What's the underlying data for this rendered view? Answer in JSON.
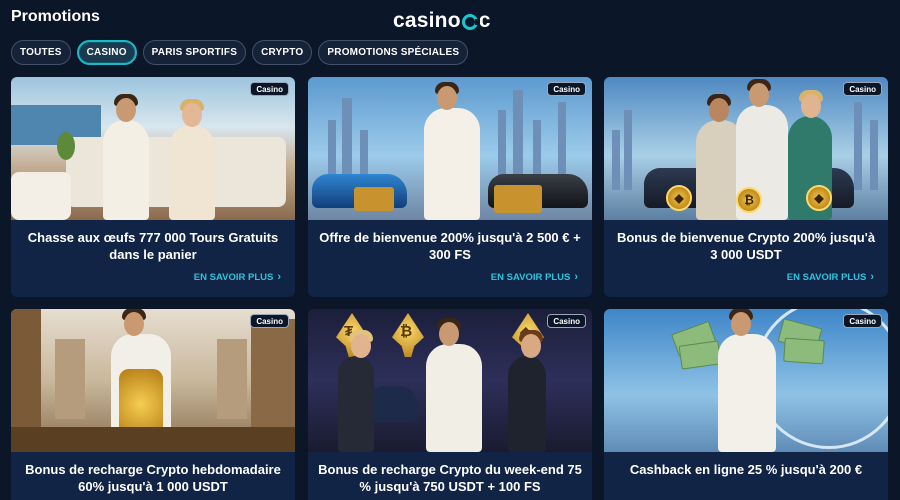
{
  "header": {
    "title": "Promotions",
    "logo_pre": "casino",
    "logo_post": "c"
  },
  "tabs": [
    {
      "label": "TOUTES"
    },
    {
      "label": "CASINO"
    },
    {
      "label": "PARIS SPORTIFS"
    },
    {
      "label": "CRYPTO"
    },
    {
      "label": "PROMOTIONS SPÉCIALES"
    }
  ],
  "active_tab": "CASINO",
  "accent_color": "#1fb6c7",
  "link_color": "#2cc4dc",
  "cards": [
    {
      "badge": "Casino",
      "title": "Chasse aux œufs 777 000 Tours Gratuits dans le panier",
      "cta": "EN SAVOIR PLUS",
      "scene": "yacht-lounge"
    },
    {
      "badge": "Casino",
      "title": "Offre de bienvenue 200% jusqu'à 2 500 € + 300 FS",
      "cta": "EN SAVOIR PLUS",
      "scene": "city-supercar"
    },
    {
      "badge": "Casino",
      "title": "Bonus de bienvenue Crypto 200% jusqu'à 3 000 USDT",
      "cta": "EN SAVOIR PLUS",
      "scene": "crypto-car"
    },
    {
      "badge": "Casino",
      "title": "Bonus de recharge Crypto hebdomadaire 60% jusqu'à 1 000 USDT",
      "cta": "",
      "scene": "gold-chains"
    },
    {
      "badge": "Casino",
      "title": "Bonus de recharge Crypto du week-end 75 % jusqu'à 750 USDT + 100 FS",
      "cta": "",
      "scene": "crypto-party"
    },
    {
      "badge": "Casino",
      "title": "Cashback en ligne 25 % jusqu'à 200 €",
      "cta": "",
      "scene": "cash-ferris-wheel"
    }
  ],
  "icons": {
    "chevron": "›",
    "btc": "₿",
    "eth": "◆",
    "tether": "₮"
  }
}
